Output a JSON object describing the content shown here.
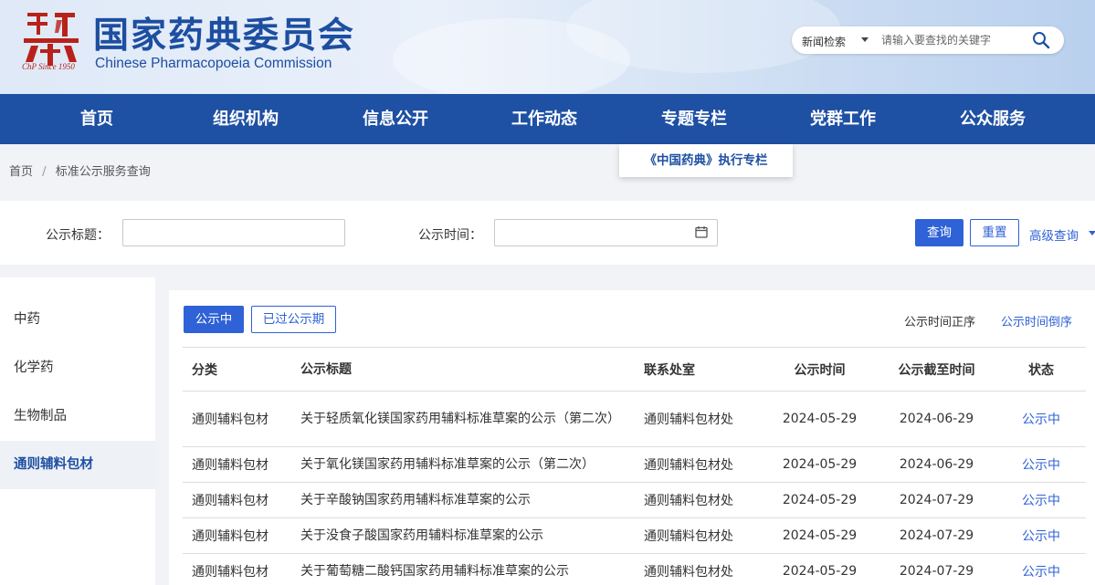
{
  "header": {
    "logo_cn": "国家药典委员会",
    "logo_en": "Chinese Pharmacopoeia Commission",
    "logo_since": "ChP Since 1950",
    "search_scope": "新闻检索",
    "search_placeholder": "请输入要查找的关键字"
  },
  "nav": {
    "items": [
      "首页",
      "组织机构",
      "信息公开",
      "工作动态",
      "专题专栏",
      "党群工作",
      "公众服务"
    ],
    "dropdown_item": "《中国药典》执行专栏"
  },
  "breadcrumb": [
    "首页",
    "/",
    "标准公示服务查询"
  ],
  "query": {
    "title_label": "公示标题：",
    "time_label": "公示时间：",
    "query_btn": "查询",
    "reset_btn": "重置",
    "advanced": "高级查询"
  },
  "sidebar": {
    "items": [
      "中药",
      "化学药",
      "生物制品",
      "通则辅料包材"
    ],
    "active_index": 3
  },
  "main": {
    "tab_active": "公示中",
    "tab_inactive": "已过公示期",
    "sort_asc": "公示时间正序",
    "sort_desc": "公示时间倒序",
    "columns": [
      "分类",
      "公示标题",
      "联系处室",
      "公示时间",
      "公示截至时间",
      "状态"
    ],
    "rows": [
      {
        "category": "通则辅料包材",
        "title": "关于轻质氧化镁国家药用辅料标准草案的公示（第二次）",
        "office": "通则辅料包材处",
        "date": "2024-05-29",
        "deadline": "2024-06-29",
        "status": "公示中"
      },
      {
        "category": "通则辅料包材",
        "title": "关于氧化镁国家药用辅料标准草案的公示（第二次）",
        "office": "通则辅料包材处",
        "date": "2024-05-29",
        "deadline": "2024-06-29",
        "status": "公示中"
      },
      {
        "category": "通则辅料包材",
        "title": "关于辛酸钠国家药用辅料标准草案的公示",
        "office": "通则辅料包材处",
        "date": "2024-05-29",
        "deadline": "2024-07-29",
        "status": "公示中"
      },
      {
        "category": "通则辅料包材",
        "title": "关于没食子酸国家药用辅料标准草案的公示",
        "office": "通则辅料包材处",
        "date": "2024-05-29",
        "deadline": "2024-07-29",
        "status": "公示中"
      },
      {
        "category": "通则辅料包材",
        "title": "关于葡萄糖二酸钙国家药用辅料标准草案的公示",
        "office": "通则辅料包材处",
        "date": "2024-05-29",
        "deadline": "2024-07-29",
        "status": "公示中"
      }
    ]
  },
  "colors": {
    "nav_bg": "#1e50a3",
    "accent": "#2f62d6",
    "seal_red": "#b8221a"
  },
  "icons": {
    "seal": "seal-logo-icon",
    "search": "search-icon",
    "calendar": "calendar-icon"
  }
}
